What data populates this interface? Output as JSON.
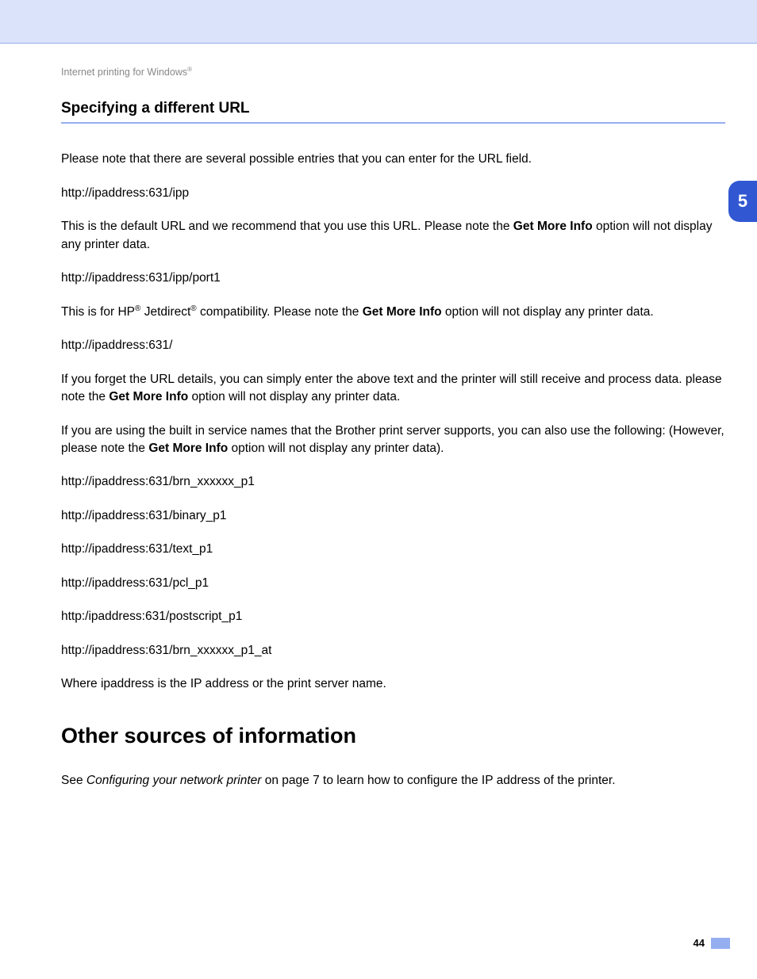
{
  "breadcrumb": {
    "prefix": "Internet printing for Windows",
    "sup": "®"
  },
  "section_title": "Specifying a different URL",
  "p_intro": "Please note that there are several possible entries that you can enter for the URL field.",
  "url1": "http://ipaddress:631/ipp",
  "p_url1_a": "This is the default URL and we recommend that you use this URL. Please note the ",
  "bold_gmi": "Get More Info",
  "p_url1_b": " option will not display any printer data.",
  "url2": "http://ipaddress:631/ipp/port1",
  "p_url2_a": "This is for HP",
  "sup_r": "®",
  "p_url2_b": " Jetdirect",
  "p_url2_c": " compatibility. Please note the ",
  "p_url2_d": " option will not display any printer data.",
  "url3": "http://ipaddress:631/",
  "p_url3_a": "If you forget the URL details, you can simply enter the above text and the printer will still receive and process data. please note the ",
  "p_url3_b": " option will not display any printer data.",
  "p_builtin_a": "If you are using the built in service names that the Brother print server supports, you can also use the following: (However, please note the ",
  "p_builtin_b": " option will not display any printer data).",
  "url_list": {
    "u1": "http://ipaddress:631/brn_xxxxxx_p1",
    "u2": "http://ipaddress:631/binary_p1",
    "u3": "http://ipaddress:631/text_p1",
    "u4": "http://ipaddress:631/pcl_p1",
    "u5": "http:/ipaddress:631/postscript_p1",
    "u6": "http://ipaddress:631/brn_xxxxxx_p1_at"
  },
  "p_where": "Where ipaddress is the IP address or the print server name.",
  "heading_other": "Other sources of information",
  "p_other_a": "See ",
  "p_other_ital": "Configuring your network printer",
  "p_other_b": " on page 7 to learn how to configure the IP address of the printer.",
  "chapter_tab": "5",
  "page_number": "44"
}
